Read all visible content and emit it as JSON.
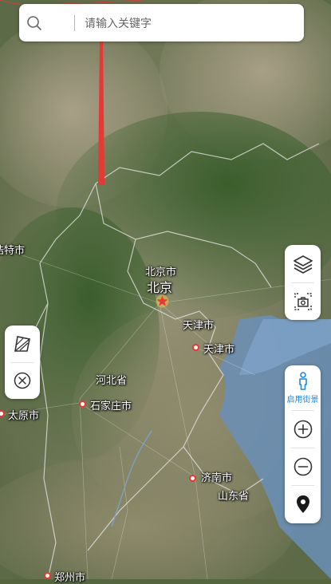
{
  "search": {
    "placeholder": "请输入关键字"
  },
  "street_view": {
    "label": "启用街景"
  },
  "places": {
    "beijing_city": "北京市",
    "beijing": "北京",
    "tianjin_city_1": "天津市",
    "tianjin_city_2": "天津市",
    "hebei": "河北省",
    "shijiazhuang": "石家庄市",
    "taiyuan": "太原市",
    "jinan": "济南市",
    "shandong": "山东省",
    "zhengzhou": "郑州市",
    "hohhot_partial": "浩特市"
  },
  "colors": {
    "arrow": "#e53935",
    "street_view_icon": "#1e88e5"
  },
  "icons": {
    "search": "search-icon",
    "layers": "layers-icon",
    "screenshot": "camera-frame-icon",
    "draw": "draw-area-icon",
    "clear": "close-circle-icon",
    "street": "person-icon",
    "zoom_in": "plus-circle-icon",
    "zoom_out": "minus-circle-icon",
    "location": "location-pin-icon"
  }
}
